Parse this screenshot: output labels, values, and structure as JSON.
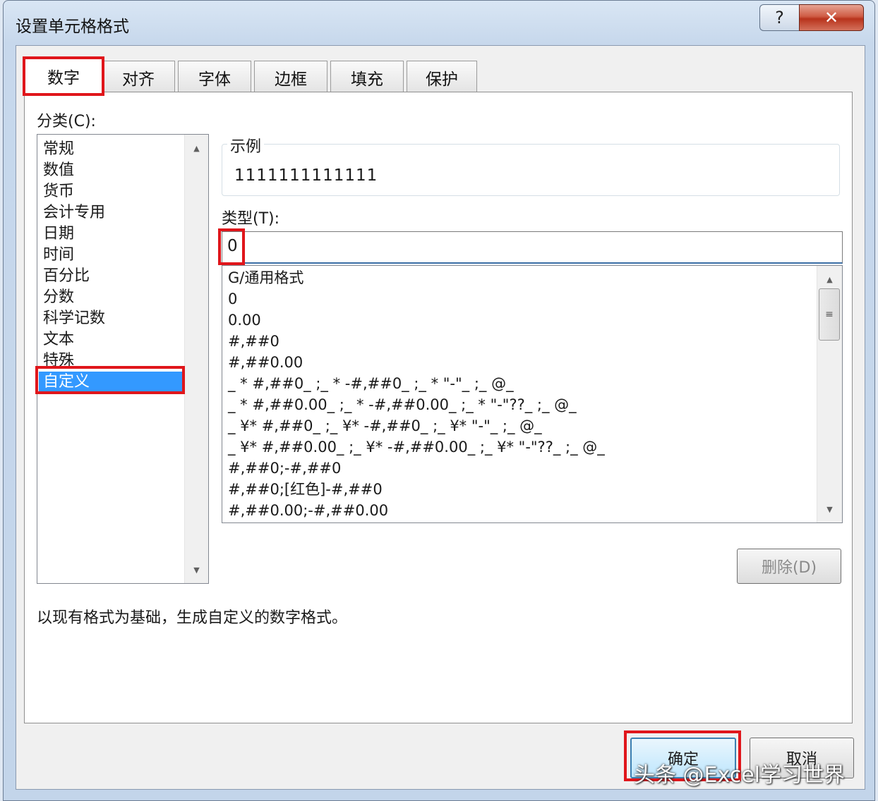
{
  "window": {
    "title": "设置单元格格式",
    "help_glyph": "?",
    "close_glyph": "✕"
  },
  "tabs": [
    {
      "label": "数字",
      "active": true
    },
    {
      "label": "对齐"
    },
    {
      "label": "字体"
    },
    {
      "label": "边框"
    },
    {
      "label": "填充"
    },
    {
      "label": "保护"
    }
  ],
  "category": {
    "label": "分类(C):",
    "items": [
      "常规",
      "数值",
      "货币",
      "会计专用",
      "日期",
      "时间",
      "百分比",
      "分数",
      "科学记数",
      "文本",
      "特殊",
      "自定义"
    ],
    "selected": "自定义"
  },
  "sample": {
    "legend": "示例",
    "value": "1111111111111"
  },
  "type": {
    "label": "类型(T):",
    "value": "0"
  },
  "formats": [
    "G/通用格式",
    "0",
    "0.00",
    "#,##0",
    "#,##0.00",
    "_ * #,##0_ ;_ * -#,##0_ ;_ * \"-\"_ ;_ @_",
    "_ * #,##0.00_ ;_ * -#,##0.00_ ;_ * \"-\"??_ ;_ @_",
    "_ ¥* #,##0_ ;_ ¥* -#,##0_ ;_ ¥* \"-\"_ ;_ @_",
    "_ ¥* #,##0.00_ ;_ ¥* -#,##0.00_ ;_ ¥* \"-\"??_ ;_ @_",
    "#,##0;-#,##0",
    "#,##0;[红色]-#,##0",
    "#,##0.00;-#,##0.00"
  ],
  "buttons": {
    "delete": "删除(D)",
    "ok": "确定",
    "cancel": "取消"
  },
  "description": "以现有格式为基础，生成自定义的数字格式。",
  "watermark": "头条 @Excel学习世界",
  "colors": {
    "highlight": "#e0161b",
    "selection": "#3399ff",
    "close": "#c8432b"
  },
  "icons": {
    "scroll_up": "triangle-up-icon",
    "scroll_down": "triangle-down-icon",
    "thumb_grip": "grip-icon"
  }
}
